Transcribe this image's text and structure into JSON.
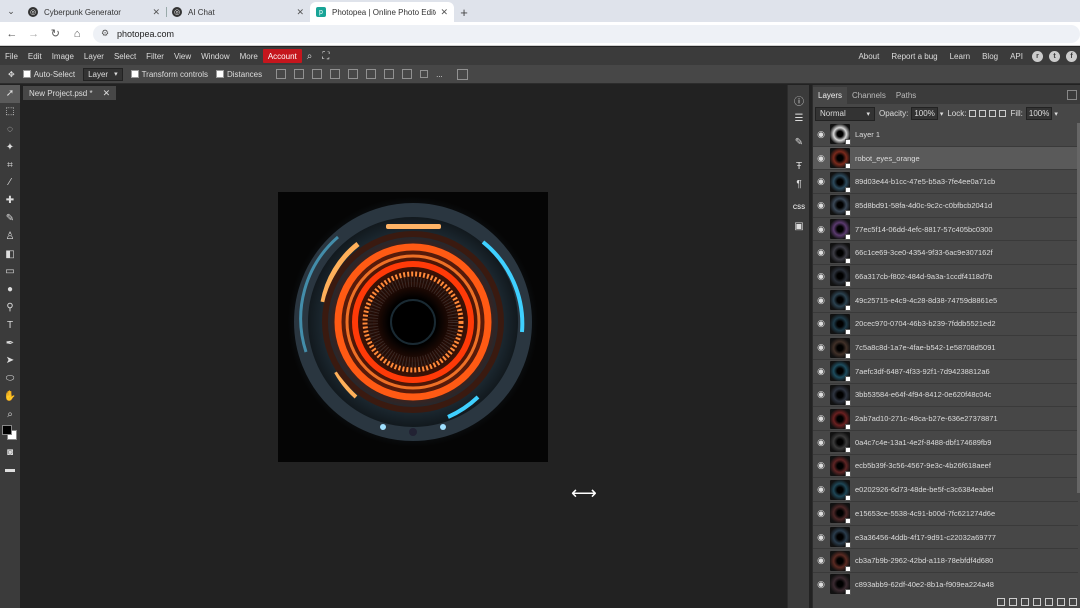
{
  "browser": {
    "tabs": [
      {
        "title": "Cyberpunk Generator",
        "active": false,
        "favicon": "openai-icon"
      },
      {
        "title": "AI Chat",
        "active": false,
        "favicon": "openai-icon"
      },
      {
        "title": "Photopea | Online Photo Editor",
        "active": true,
        "favicon": "photopea-icon"
      }
    ],
    "url": "photopea.com"
  },
  "menubar": {
    "left": [
      "File",
      "Edit",
      "Image",
      "Layer",
      "Select",
      "Filter",
      "View",
      "Window",
      "More",
      "Account"
    ],
    "right": [
      "About",
      "Report a bug",
      "Learn",
      "Blog",
      "API"
    ]
  },
  "options": {
    "auto_select": "Auto-Select",
    "layer_select": "Layer",
    "transform_controls": "Transform controls",
    "distances": "Distances",
    "more": "..."
  },
  "document": {
    "tab_title": "New Project.psd *"
  },
  "panel": {
    "tabs": [
      "Layers",
      "Channels",
      "Paths"
    ],
    "blend_mode": "Normal",
    "opacity_label": "Opacity:",
    "opacity": "100%",
    "lock_label": "Lock:",
    "fill_label": "Fill:",
    "fill": "100%",
    "layers": [
      {
        "name": "Layer 1",
        "thumb": "#d8d8d8",
        "selected": false
      },
      {
        "name": "robot_eyes_orange",
        "thumb": "#7a2a1c",
        "selected": true
      },
      {
        "name": "89d03e44-b1cc-47e5-b5a3-7fe4ee0a71cb",
        "thumb": "#2c4a5c",
        "selected": false
      },
      {
        "name": "85d8bd91-58fa-4d0c-9c2c-c0bfbcb2041d",
        "thumb": "#3a4756",
        "selected": false
      },
      {
        "name": "77ec5f14-06dd-4efc-8817-57c405bc0300",
        "thumb": "#5a3a6e",
        "selected": false
      },
      {
        "name": "66c1ce69-3ce0-4354-9f33-6ac9e307162f",
        "thumb": "#3c3c44",
        "selected": false
      },
      {
        "name": "66a317cb-f802-484d-9a3a-1ccdf4118d7b",
        "thumb": "#2a2f38",
        "selected": false
      },
      {
        "name": "49c25715-e4c9-4c28-8d38-74759d8861e5",
        "thumb": "#2b4250",
        "selected": false
      },
      {
        "name": "20cec970-0704-46b3-b239-7fddb5521ed2",
        "thumb": "#1e3a48",
        "selected": false
      },
      {
        "name": "7c5a8c8d-1a7e-4fae-b542-1e58708d5091",
        "thumb": "#403028",
        "selected": false
      },
      {
        "name": "7aefc3df-6487-4f33-92f1-7d94238812a6",
        "thumb": "#1d4c5e",
        "selected": false
      },
      {
        "name": "3bb53584-e64f-4f94-8412-0e620f48c04c",
        "thumb": "#2e3440",
        "selected": false
      },
      {
        "name": "2ab7ad10-271c-49ca-b27e-636e27378871",
        "thumb": "#6a2020",
        "selected": false
      },
      {
        "name": "0a4c7c4e-13a1-4e2f-8488-dbf174689fb9",
        "thumb": "#3a3a3a",
        "selected": false
      },
      {
        "name": "ecb5b39f-3c56-4567-9e3c-4b26f618aeef",
        "thumb": "#5e2424",
        "selected": false
      },
      {
        "name": "e0202926-6d73-48de-be5f-c3c6384eabef",
        "thumb": "#1e4656",
        "selected": false
      },
      {
        "name": "e15653ce-5538-4c91-b00d-7fc621274d6e",
        "thumb": "#4a2626",
        "selected": false
      },
      {
        "name": "e3a36456-4ddb-4f17-9d91-c22032a69777",
        "thumb": "#2a3c4c",
        "selected": false
      },
      {
        "name": "cb3a7b9b-2962-42bd-a118-78ebfdf4d680",
        "thumb": "#5a2a22",
        "selected": false
      },
      {
        "name": "c893abb9-62df-40e2-8b1a-f909ea224a48",
        "thumb": "#3a2a30",
        "selected": false
      }
    ]
  }
}
